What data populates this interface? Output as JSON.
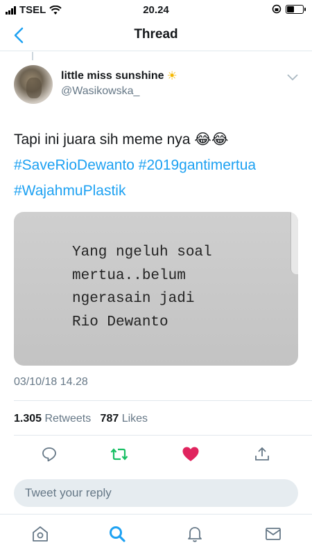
{
  "status_bar": {
    "carrier": "TSEL",
    "time": "20.24"
  },
  "nav": {
    "title": "Thread",
    "back_icon": "chevron-left-icon"
  },
  "tweet": {
    "display_name": "little miss sunshine",
    "name_emoji": "☀",
    "handle": "@Wasikowska_",
    "text": "Tapi ini juara sih meme nya",
    "text_emoji": "😂😂",
    "hashtags": [
      "#SaveRioDewanto",
      "#2019gantimertua",
      "#WajahmuPlastik"
    ],
    "image_text": "Yang ngeluh soal\nmertua..belum\nngerasain jadi\nRio Dewanto",
    "timestamp": "03/10/18 14.28",
    "retweets_count": "1.305",
    "retweets_label": "Retweets",
    "likes_count": "787",
    "likes_label": "Likes"
  },
  "reply": {
    "placeholder": "Tweet your reply"
  },
  "colors": {
    "accent": "#1da1f2",
    "retweet": "#17bf63",
    "like": "#e0245e",
    "icon_gray": "#657786"
  }
}
